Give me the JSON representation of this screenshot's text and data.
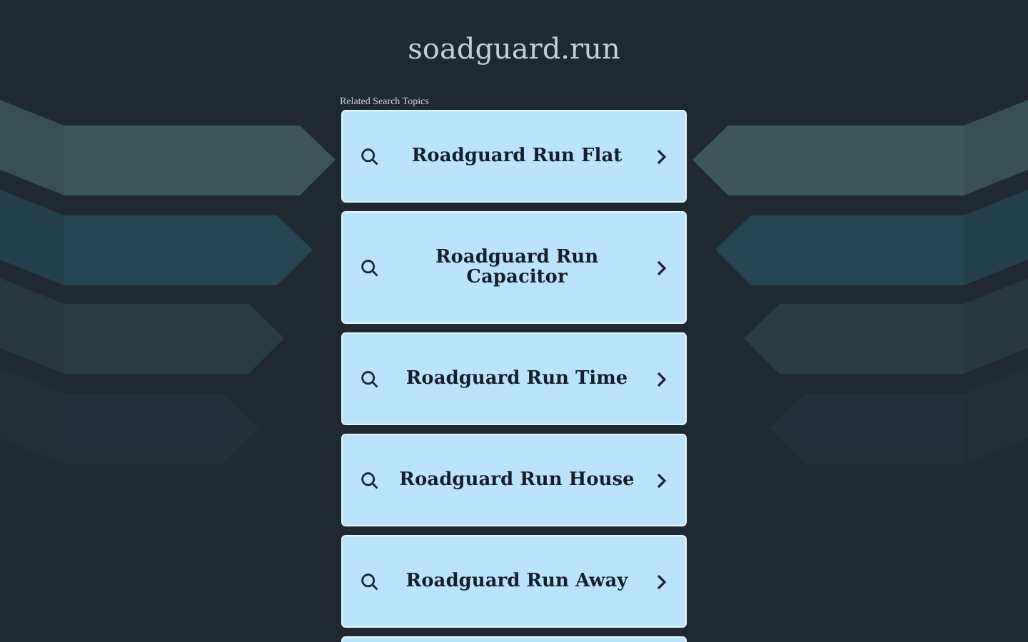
{
  "site_title": "soadguard.run",
  "section_label": "Related Search Topics",
  "links": [
    {
      "label": "Roadguard Run Flat"
    },
    {
      "label": "Roadguard Run Capacitor"
    },
    {
      "label": "Roadguard Run Time"
    },
    {
      "label": "Roadguard Run House"
    },
    {
      "label": "Roadguard Run Away"
    }
  ]
}
